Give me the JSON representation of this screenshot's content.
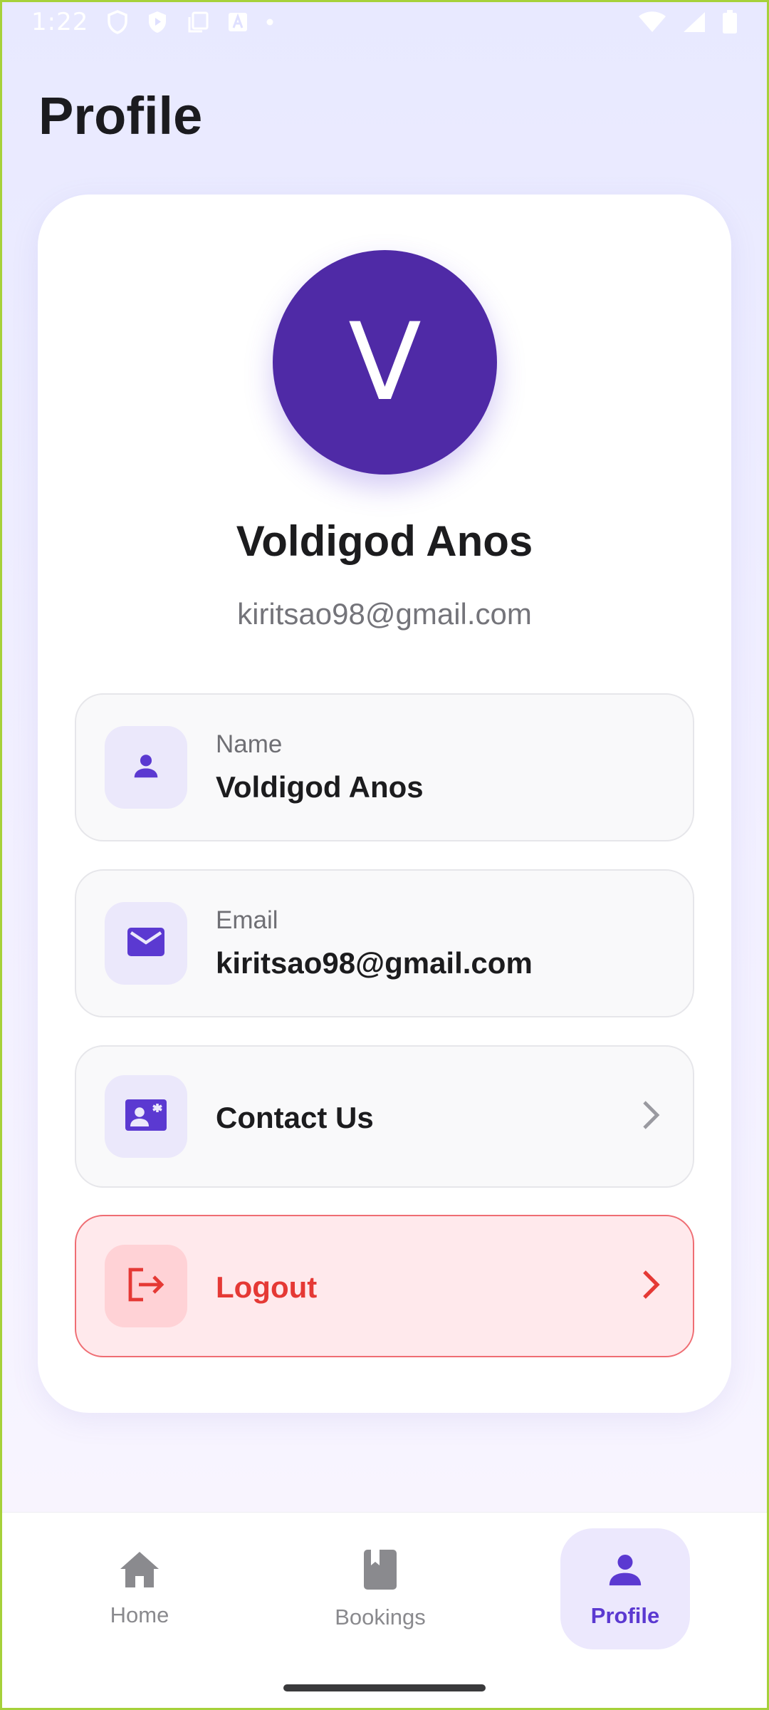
{
  "status_bar": {
    "time": "1:22",
    "left_icons": [
      "shield-icon",
      "play-protect-icon",
      "copy-icon",
      "a-box-icon",
      "dot-icon"
    ],
    "right_icons": [
      "wifi-icon",
      "signal-icon",
      "battery-icon"
    ]
  },
  "page": {
    "title": "Profile"
  },
  "profile": {
    "avatar_initial": "V",
    "avatar_color": "#4f2aa6",
    "name": "Voldigod Anos",
    "email": "kiritsao98@gmail.com"
  },
  "rows": {
    "name": {
      "label": "Name",
      "value": "Voldigod Anos",
      "icon": "person-icon"
    },
    "email": {
      "label": "Email",
      "value": "kiritsao98@gmail.com",
      "icon": "mail-icon"
    },
    "contact": {
      "title": "Contact Us",
      "icon": "contact-card-icon"
    },
    "logout": {
      "title": "Logout",
      "icon": "logout-icon",
      "color": "#e53935"
    }
  },
  "bottom_nav": {
    "items": [
      {
        "label": "Home",
        "icon": "home-icon",
        "active": false
      },
      {
        "label": "Bookings",
        "icon": "book-icon",
        "active": false
      },
      {
        "label": "Profile",
        "icon": "person-icon",
        "active": true
      }
    ]
  },
  "colors": {
    "accent": "#5b39d1",
    "danger": "#e53935",
    "icon_tile": "#ebe8fb"
  }
}
